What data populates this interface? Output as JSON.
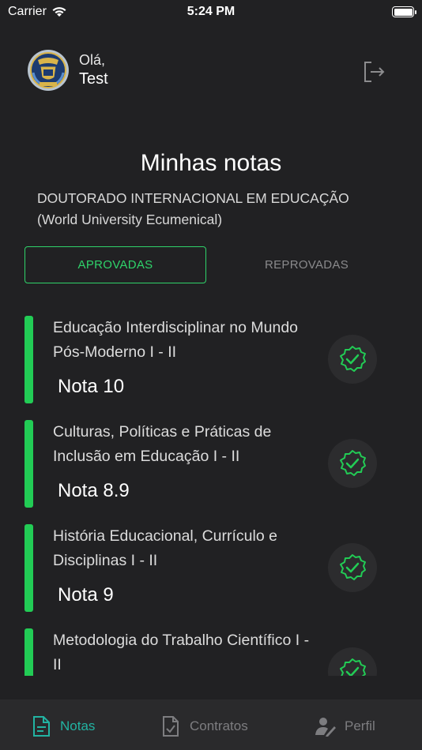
{
  "status_bar": {
    "carrier": "Carrier",
    "time": "5:24 PM"
  },
  "header": {
    "greeting": "Olá,",
    "username": "Test"
  },
  "page": {
    "title": "Minhas notas",
    "course": "DOUTORADO INTERNACIONAL EM EDUCAÇÃO (World University Ecumenical)"
  },
  "tabs": [
    {
      "label": "APROVADAS"
    },
    {
      "label": "REPROVADAS"
    }
  ],
  "grades": [
    {
      "subject": "Educação Interdisciplinar no Mundo Pós-Moderno I - II",
      "grade": "Nota 10"
    },
    {
      "subject": "Culturas, Políticas e Práticas de Inclusão em Educação I - II",
      "grade": "Nota 8.9"
    },
    {
      "subject": "História Educacional, Currículo e Disciplinas I - II",
      "grade": "Nota 9"
    },
    {
      "subject": "Metodologia do Trabalho Científico I - II",
      "grade": ""
    }
  ],
  "nav": [
    {
      "label": "Notas"
    },
    {
      "label": "Contratos"
    },
    {
      "label": "Perfil"
    }
  ],
  "colors": {
    "background": "#212123",
    "accent_green": "#22cc55",
    "nav_active": "#22b3a2"
  },
  "icons": {
    "wifi": "wifi-icon",
    "battery": "battery-icon",
    "avatar": "university-seal",
    "logout": "logout-icon",
    "check": "check-badge-icon",
    "notas": "document-icon",
    "contratos": "contract-check-icon",
    "perfil": "user-edit-icon"
  }
}
